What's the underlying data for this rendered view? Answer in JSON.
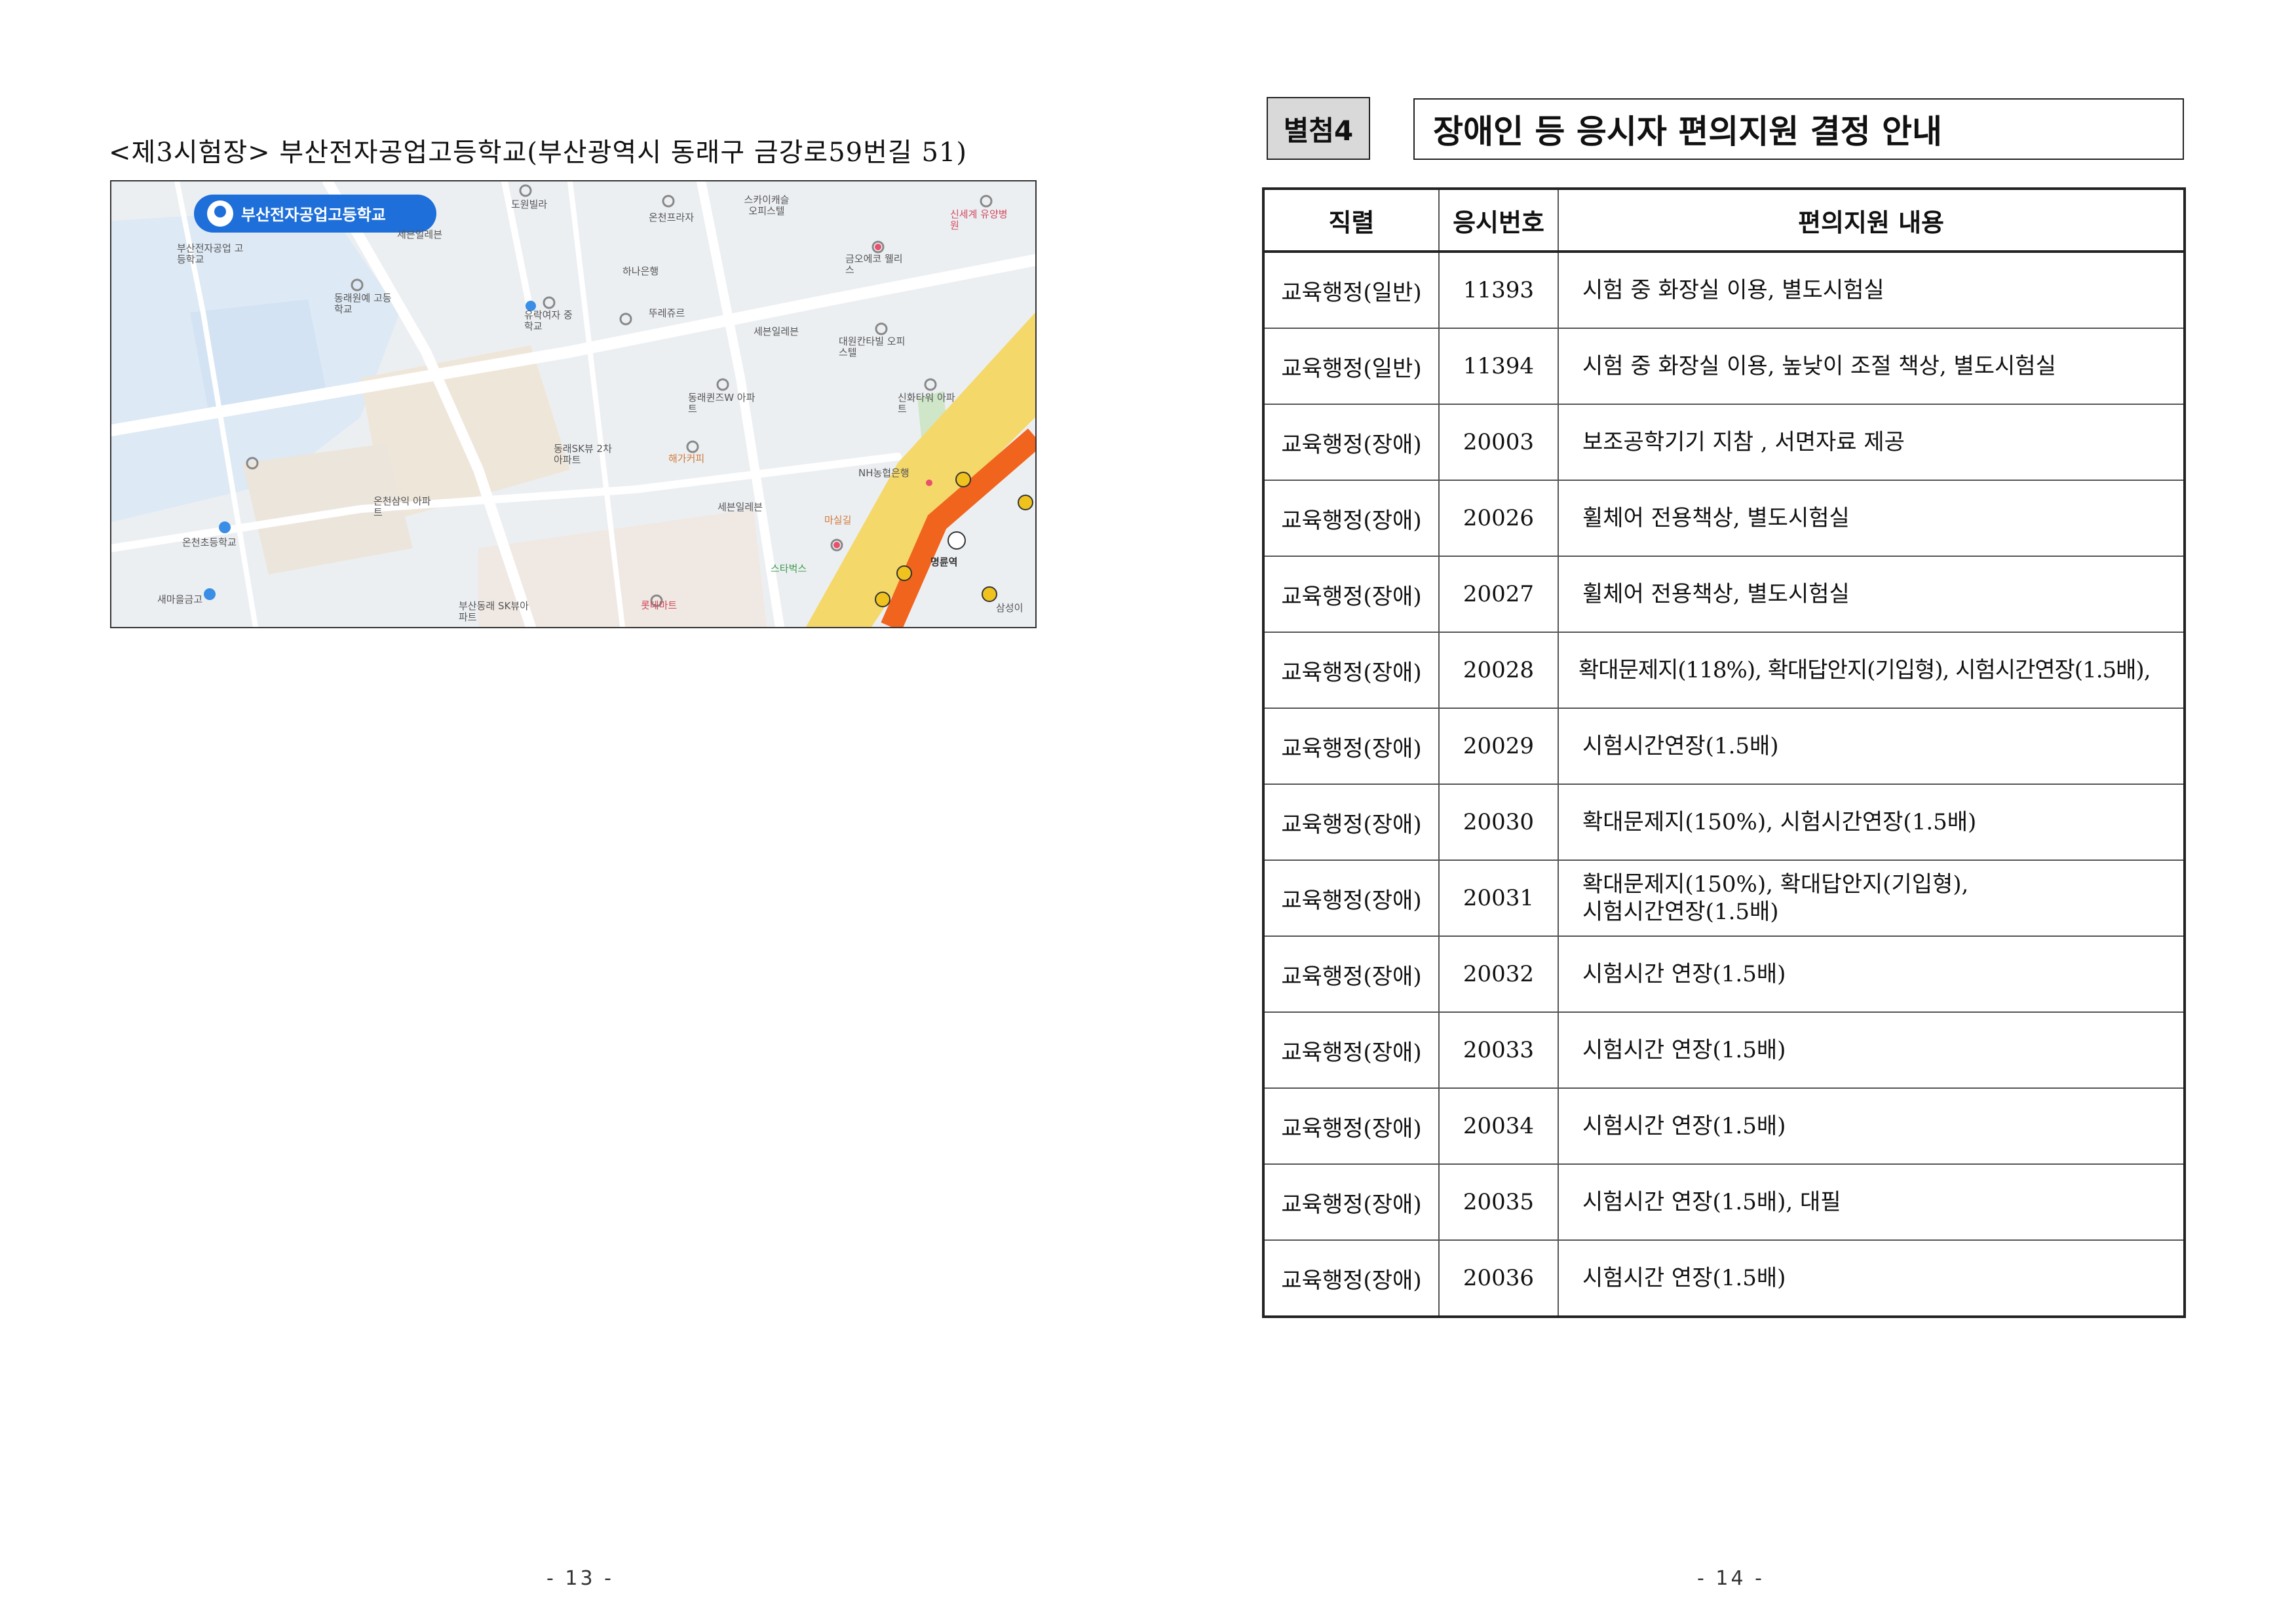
{
  "left_page": {
    "venue_title": "<제3시험장> 부산전자공업고등학교(부산광역시 동래구 금강로59번길 51)",
    "map": {
      "pin_label": "부산전자공업고등학교",
      "labels": [
        {
          "text": "도원빌라",
          "icon": "poi-circle"
        },
        {
          "text": "온천프라자"
        },
        {
          "text": "스카이캐슬 오피스텔"
        },
        {
          "text": "신세계 유양병원"
        },
        {
          "text": "세븐일레븐"
        },
        {
          "text": "부산전자공업 고등학교"
        },
        {
          "text": "하나은행"
        },
        {
          "text": "금오에코 웰리스"
        },
        {
          "text": "동래원예 고등학교"
        },
        {
          "text": "유락여자 중학교"
        },
        {
          "text": "뚜레쥬르"
        },
        {
          "text": "세븐일레븐"
        },
        {
          "text": "대원칸타빌 오피스텔"
        },
        {
          "text": "동래퀸즈W 아파트"
        },
        {
          "text": "신화타워 아파트"
        },
        {
          "text": "동래SK뷰 2차아파트"
        },
        {
          "text": "해가커피"
        },
        {
          "text": "NH농협은행"
        },
        {
          "text": "온천삼익 아파트"
        },
        {
          "text": "세븐일레븐"
        },
        {
          "text": "마실길"
        },
        {
          "text": "온천초등학교"
        },
        {
          "text": "명륜역"
        },
        {
          "text": "스타벅스"
        },
        {
          "text": "새마을금고"
        },
        {
          "text": "부산동래 SK뷰아파트"
        },
        {
          "text": "롯데마트"
        },
        {
          "text": "삼성이"
        }
      ]
    },
    "page_number": "- 13 -"
  },
  "right_page": {
    "annex_badge": "별첨4",
    "annex_title": "장애인 등 응시자 편의지원 결정 안내",
    "table": {
      "headers": [
        "직렬",
        "응시번호",
        "편의지원 내용"
      ],
      "rows": [
        {
          "job": "교육행정(일반)",
          "number": "11393",
          "desc": [
            "시험 중 화장실 이용, 별도시험실"
          ]
        },
        {
          "job": "교육행정(일반)",
          "number": "11394",
          "desc": [
            "시험 중 화장실 이용, 높낮이 조절 책상, 별도시험실"
          ]
        },
        {
          "job": "교육행정(장애)",
          "number": "20003",
          "desc": [
            "보조공학기기 지참 , 서면자료 제공"
          ]
        },
        {
          "job": "교육행정(장애)",
          "number": "20026",
          "desc": [
            "휠체어 전용책상, 별도시험실"
          ]
        },
        {
          "job": "교육행정(장애)",
          "number": "20027",
          "desc": [
            "휠체어 전용책상, 별도시험실"
          ]
        },
        {
          "job": "교육행정(장애)",
          "number": "20028",
          "desc": [
            "확대문제지(118%), 확대답안지(기입형), 시험시간연장(1.5배),"
          ]
        },
        {
          "job": "교육행정(장애)",
          "number": "20029",
          "desc": [
            "시험시간연장(1.5배)"
          ]
        },
        {
          "job": "교육행정(장애)",
          "number": "20030",
          "desc": [
            "확대문제지(150%), 시험시간연장(1.5배)"
          ]
        },
        {
          "job": "교육행정(장애)",
          "number": "20031",
          "desc": [
            "확대문제지(150%), 확대답안지(기입형),",
            "시험시간연장(1.5배)"
          ]
        },
        {
          "job": "교육행정(장애)",
          "number": "20032",
          "desc": [
            "시험시간 연장(1.5배)"
          ]
        },
        {
          "job": "교육행정(장애)",
          "number": "20033",
          "desc": [
            "시험시간 연장(1.5배)"
          ]
        },
        {
          "job": "교육행정(장애)",
          "number": "20034",
          "desc": [
            "시험시간 연장(1.5배)"
          ]
        },
        {
          "job": "교육행정(장애)",
          "number": "20035",
          "desc": [
            "시험시간 연장(1.5배), 대필"
          ]
        },
        {
          "job": "교육행정(장애)",
          "number": "20036",
          "desc": [
            "시험시간 연장(1.5배)"
          ]
        }
      ]
    },
    "page_number": "- 14 -"
  },
  "colors": {
    "badge_bg": "#d9d9d9",
    "pin_blue": "#1e6fd9",
    "subway_orange": "#f0641e",
    "road_yellow": "#f5d86a"
  }
}
